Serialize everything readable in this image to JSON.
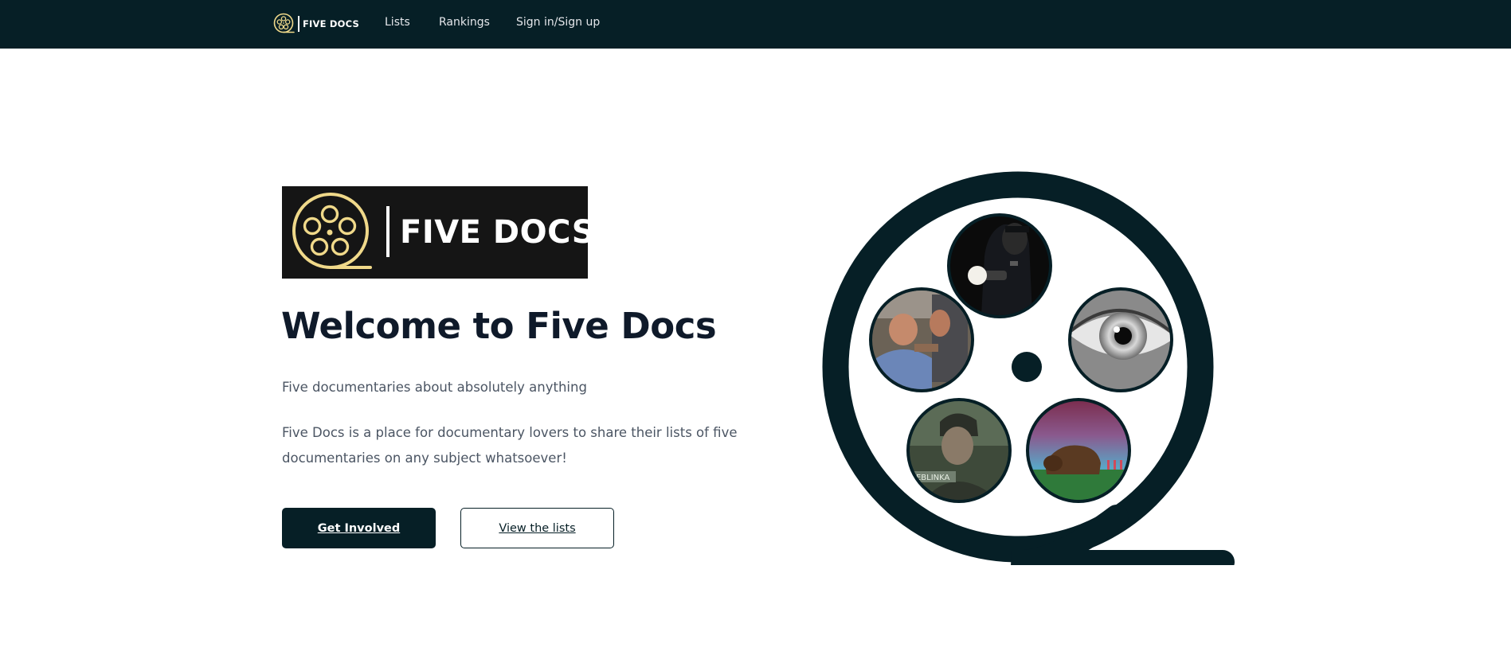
{
  "nav": {
    "brand_text": "FIVE DOCS",
    "links": [
      {
        "label": "Lists"
      },
      {
        "label": "Rankings"
      },
      {
        "label": "Sign in/Sign up"
      }
    ]
  },
  "hero": {
    "logo_text": "FIVE DOCS",
    "title": "Welcome to Five Docs",
    "tagline": "Five documentaries about absolutely anything",
    "description": "Five Docs is a place for documentary lovers to share their lists of five documentaries on any subject whatsoever!",
    "primary_button": "Get Involved",
    "secondary_button": "View the lists"
  },
  "reel": {
    "film_stills": [
      {
        "name": "film-still-police-flashlight"
      },
      {
        "name": "film-still-workers"
      },
      {
        "name": "film-still-eye"
      },
      {
        "name": "film-still-treblinka",
        "caption": "REBLINKA"
      },
      {
        "name": "film-still-bison"
      }
    ]
  },
  "colors": {
    "navbar": "#061f26",
    "accent_gold": "#f0d98a",
    "logo_bg": "#151515",
    "button_primary": "#061f26"
  }
}
